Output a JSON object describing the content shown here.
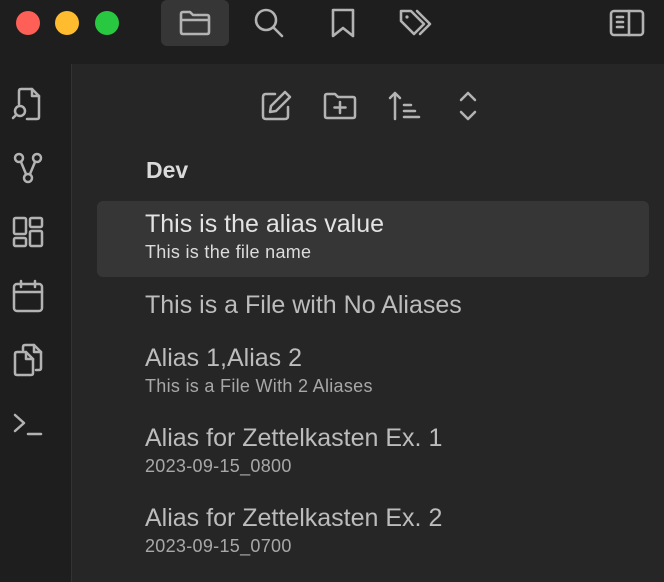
{
  "window": {
    "traffic_lights": [
      "close",
      "minimize",
      "zoom"
    ]
  },
  "toolbar": {
    "tabs": [
      {
        "icon": "folder-icon",
        "active": true
      },
      {
        "icon": "search-icon",
        "active": false
      },
      {
        "icon": "bookmark-icon",
        "active": false
      },
      {
        "icon": "tags-icon",
        "active": false
      }
    ],
    "right_icon": "sidebar-toggle-icon"
  },
  "ribbon": {
    "items": [
      "file-search-icon",
      "graph-icon",
      "dashboard-icon",
      "calendar-icon",
      "copy-icon",
      "terminal-icon"
    ]
  },
  "nav": {
    "buttons": [
      "new-note-icon",
      "new-folder-icon",
      "sort-icon",
      "collapse-icon"
    ]
  },
  "explorer": {
    "folder_name": "Dev",
    "files": [
      {
        "title": "This is the alias value",
        "subtitle": "This is the file name",
        "active": true
      },
      {
        "title": "This is a File with No Aliases",
        "subtitle": "",
        "active": false
      },
      {
        "title": "Alias 1,Alias 2",
        "subtitle": "This is a File With 2 Aliases",
        "active": false
      },
      {
        "title": "Alias for Zettelkasten Ex. 1",
        "subtitle": "2023-09-15_0800",
        "active": false
      },
      {
        "title": "Alias for Zettelkasten Ex. 2",
        "subtitle": "2023-09-15_0700",
        "active": false
      }
    ]
  },
  "colors": {
    "background": "#262626",
    "titlebar": "#1e1e1e",
    "active_row": "#363636",
    "icon": "#b3b3b3",
    "text": "#bcbcbc"
  }
}
